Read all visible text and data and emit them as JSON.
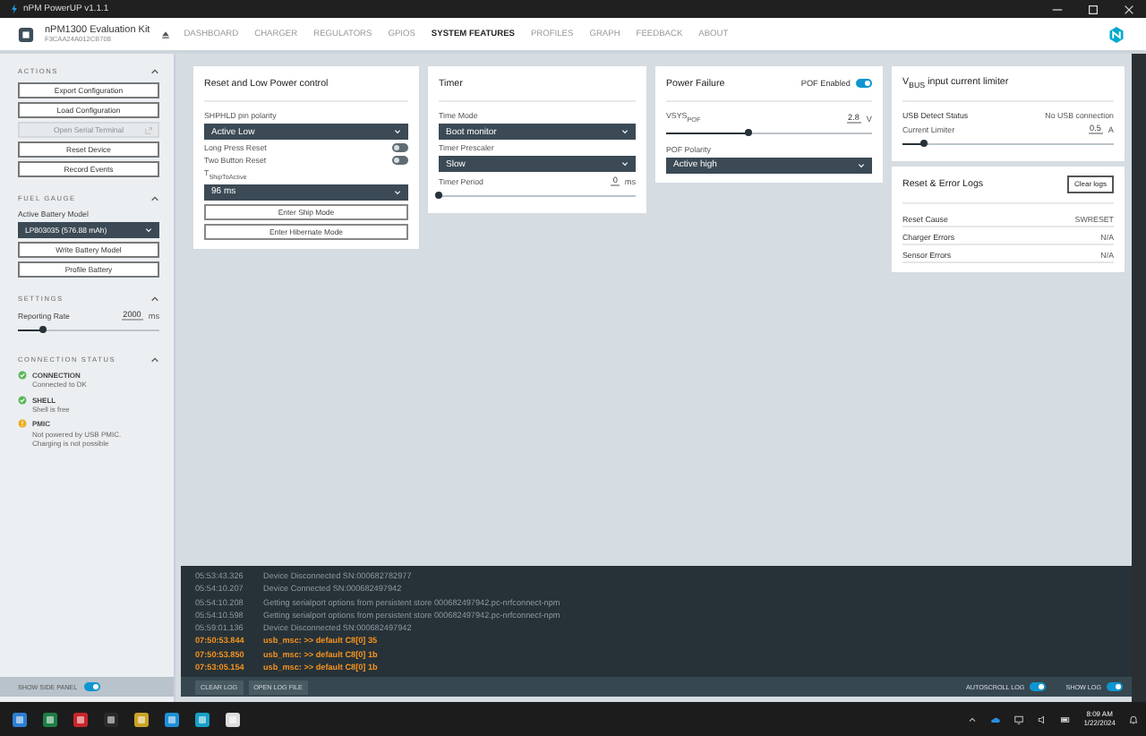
{
  "window": {
    "title": "nPM PowerUP v1.1.1"
  },
  "device": {
    "name": "nPM1300 Evaluation Kit",
    "serial": "F3CAA24A012CB708"
  },
  "nav": [
    {
      "label": "DASHBOARD",
      "selected": false
    },
    {
      "label": "CHARGER",
      "selected": false
    },
    {
      "label": "REGULATORS",
      "selected": false
    },
    {
      "label": "GPIOS",
      "selected": false
    },
    {
      "label": "SYSTEM FEATURES",
      "selected": true
    },
    {
      "label": "PROFILES",
      "selected": false
    },
    {
      "label": "GRAPH",
      "selected": false
    },
    {
      "label": "FEEDBACK",
      "selected": false
    },
    {
      "label": "ABOUT",
      "selected": false
    }
  ],
  "sidebar": {
    "actions": {
      "title": "ACTIONS",
      "buttons": [
        {
          "label": "Export Configuration",
          "disabled": false,
          "external": false
        },
        {
          "label": "Load Configuration",
          "disabled": false,
          "external": false
        },
        {
          "label": "Open Serial Terminal",
          "disabled": true,
          "external": true
        },
        {
          "label": "Reset Device",
          "disabled": false,
          "external": false
        },
        {
          "label": "Record Events",
          "disabled": false,
          "external": false
        }
      ]
    },
    "fuel_gauge": {
      "title": "FUEL GAUGE",
      "label": "Active Battery Model",
      "value": "LP803035 (576.88 mAh)",
      "buttons": [
        "Write Battery Model",
        "Profile Battery"
      ]
    },
    "settings": {
      "title": "SETTINGS",
      "label": "Reporting Rate",
      "value": "2000",
      "unit": "ms",
      "level": 0.18
    },
    "connection": {
      "title": "CONNECTION STATUS",
      "items": [
        {
          "name": "CONNECTION",
          "kind": "ok",
          "lines": [
            "Connected to DK"
          ]
        },
        {
          "name": "SHELL",
          "kind": "ok",
          "lines": [
            "Shell is free"
          ]
        },
        {
          "name": "PMIC",
          "kind": "warning",
          "lines": [
            "Not powered by USB PMIC.",
            "Charging is not possible"
          ]
        }
      ]
    },
    "show_side_panel": {
      "label": "SHOW SIDE PANEL",
      "on": true
    }
  },
  "columns": [
    [
      {
        "title": "Reset and Low Power control",
        "items": [
          {
            "kind": "select",
            "label": "SHPHLD pin polarity",
            "value": "Active Low"
          },
          {
            "kind": "toggle",
            "label": "Long Press Reset",
            "on": false
          },
          {
            "kind": "toggle",
            "label": "Two Button Reset",
            "on": false
          },
          {
            "kind": "select",
            "label": "T$_{ShipToActive}$",
            "value": "96 ms"
          },
          {
            "kind": "button",
            "label": "Enter Ship Mode"
          },
          {
            "kind": "button",
            "label": "Enter Hibernate Mode"
          }
        ]
      }
    ],
    [
      {
        "title": "Timer",
        "items": [
          {
            "kind": "select",
            "label": "Time Mode",
            "value": "Boot monitor"
          },
          {
            "kind": "select",
            "label": "Timer Prescaler",
            "value": "Slow"
          },
          {
            "kind": "slider",
            "label": "Timer Period",
            "value": "0",
            "unit": "ms",
            "level": 0
          }
        ]
      }
    ],
    [
      {
        "title": "Power Failure",
        "header_toggle": {
          "label": "POF Enabled",
          "on": true
        },
        "items": [
          {
            "kind": "slider",
            "label": "VSYS$_{POF}$",
            "value": "2.8",
            "unit": "V",
            "level": 0.4
          },
          {
            "kind": "select",
            "label": "POF Polarity",
            "value": "Active high"
          }
        ]
      }
    ],
    [
      {
        "title": "V$_{BUS}$ input current limiter",
        "items": [
          {
            "kind": "info",
            "label": "USB Detect Status",
            "value": "No USB connection"
          },
          {
            "kind": "slider",
            "label": "Current Limiter",
            "value": "0.5",
            "unit": "A",
            "level": 0.1
          }
        ]
      },
      {
        "title": "Reset & Error Logs",
        "header_button": "Clear logs",
        "items": [
          {
            "kind": "row",
            "label": "Reset Cause",
            "value": "SWRESET"
          },
          {
            "kind": "row",
            "label": "Charger Errors",
            "value": "N/A"
          },
          {
            "kind": "row",
            "label": "Sensor Errors",
            "value": "N/A"
          }
        ]
      }
    ]
  ],
  "log": {
    "entries": [
      {
        "time": "05:53:43.326",
        "message": "Device Disconnected SN:000682782977",
        "kind": "info"
      },
      {
        "time": "05:54:10.207",
        "message": "Device Connected SN:000682497942",
        "kind": "info"
      },
      {
        "time": "05:54:10.208",
        "message": "Getting serialport options from persistent store 000682497942.pc-nrfconnect-npm",
        "kind": "info"
      },
      {
        "time": "05:54:10.598",
        "message": "Getting serialport options from persistent store 000682497942.pc-nrfconnect-npm",
        "kind": "info"
      },
      {
        "time": "05:59:01.136",
        "message": "Device Disconnected SN:000682497942",
        "kind": "info"
      },
      {
        "time": "07:50:53.844",
        "message": "usb_msc: >> default C8[0] 35",
        "kind": "warning"
      },
      {
        "time": "07:50:53.850",
        "message": "usb_msc: >> default C8[0] 1b",
        "kind": "warning"
      },
      {
        "time": "07:53:05.154",
        "message": "usb_msc: >> default C8[0] 1b",
        "kind": "warning"
      }
    ],
    "buttons": [
      "CLEAR LOG",
      "OPEN LOG FILE"
    ],
    "toggles": [
      {
        "label": "AUTOSCROLL LOG",
        "on": true
      },
      {
        "label": "SHOW LOG",
        "on": true
      }
    ]
  },
  "taskbar": {
    "time": "8:09 AM",
    "date": "1/22/2024"
  }
}
